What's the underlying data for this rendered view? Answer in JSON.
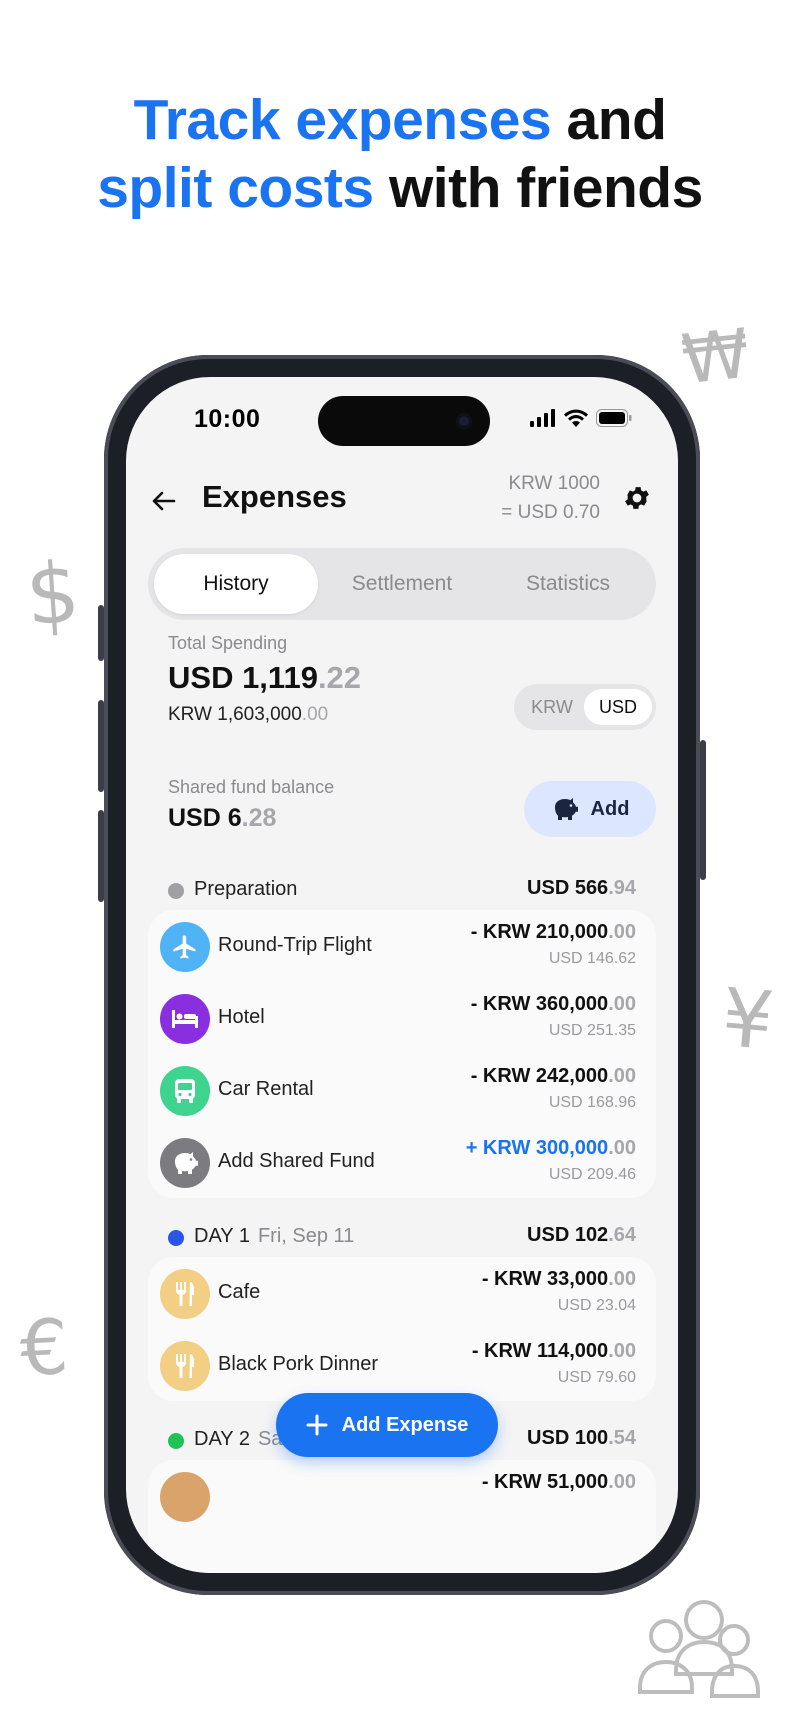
{
  "headline": {
    "line1_blue": "Track expenses",
    "line1_dark": " and",
    "line2_blue": "split costs",
    "line2_dark": " with friends"
  },
  "colors": {
    "accent": "#1a73f0",
    "preparation": "#a0a0a4",
    "day1": "#2c55e8",
    "day2": "#1fc257"
  },
  "status_bar": {
    "time": "10:00"
  },
  "header": {
    "title": "Expenses",
    "rate_line1": "KRW 1000",
    "rate_line2": "= USD 0.70"
  },
  "tabs": [
    {
      "label": "History",
      "active": true
    },
    {
      "label": "Settlement",
      "active": false
    },
    {
      "label": "Statistics",
      "active": false
    }
  ],
  "summary": {
    "total_label": "Total Spending",
    "total_usd_int": "USD 1,119",
    "total_usd_dec": ".22",
    "total_krw_int": "KRW 1,603,000",
    "total_krw_dec": ".00",
    "currency_options": [
      "KRW",
      "USD"
    ],
    "currency_selected": "USD",
    "fund_label": "Shared fund balance",
    "fund_int": "USD 6",
    "fund_dec": ".28",
    "fund_add_label": "Add"
  },
  "groups": [
    {
      "name": "Preparation",
      "date": "",
      "total_int": "USD 566",
      "total_dec": ".94",
      "items": [
        {
          "name": "Round-Trip Flight",
          "icon": "airplane-icon",
          "amount_int": "- KRW 210,000",
          "amount_dec": ".00",
          "sub": "USD 146.62"
        },
        {
          "name": "Hotel",
          "icon": "bed-icon",
          "amount_int": "- KRW 360,000",
          "amount_dec": ".00",
          "sub": "USD 251.35"
        },
        {
          "name": "Car Rental",
          "icon": "bus-icon",
          "amount_int": "- KRW 242,000",
          "amount_dec": ".00",
          "sub": "USD 168.96"
        },
        {
          "name": "Add Shared Fund",
          "icon": "piggy-bank-icon",
          "amount_int": "+ KRW 300,000",
          "amount_dec": ".00",
          "sub": "USD 209.46"
        }
      ]
    },
    {
      "name": "DAY 1",
      "date": "Fri, Sep 11",
      "total_int": "USD 102",
      "total_dec": ".64",
      "items": [
        {
          "name": "Cafe",
          "icon": "fork-knife-icon",
          "amount_int": "- KRW 33,000",
          "amount_dec": ".00",
          "sub": "USD 23.04"
        },
        {
          "name": "Black Pork Dinner",
          "icon": "fork-knife-icon",
          "amount_int": "- KRW 114,000",
          "amount_dec": ".00",
          "sub": "USD 79.60"
        }
      ]
    },
    {
      "name": "DAY 2",
      "date": "Sat, Sep 12",
      "total_int": "USD 100",
      "total_dec": ".54",
      "items": [
        {
          "name": "",
          "icon": "food-icon",
          "amount_int": "- KRW 51,000",
          "amount_dec": ".00",
          "sub": ""
        }
      ]
    }
  ],
  "fab": {
    "label": "Add Expense"
  },
  "decorations": {
    "won": "₩",
    "dollar": "$",
    "yen": "¥",
    "euro": "€"
  }
}
